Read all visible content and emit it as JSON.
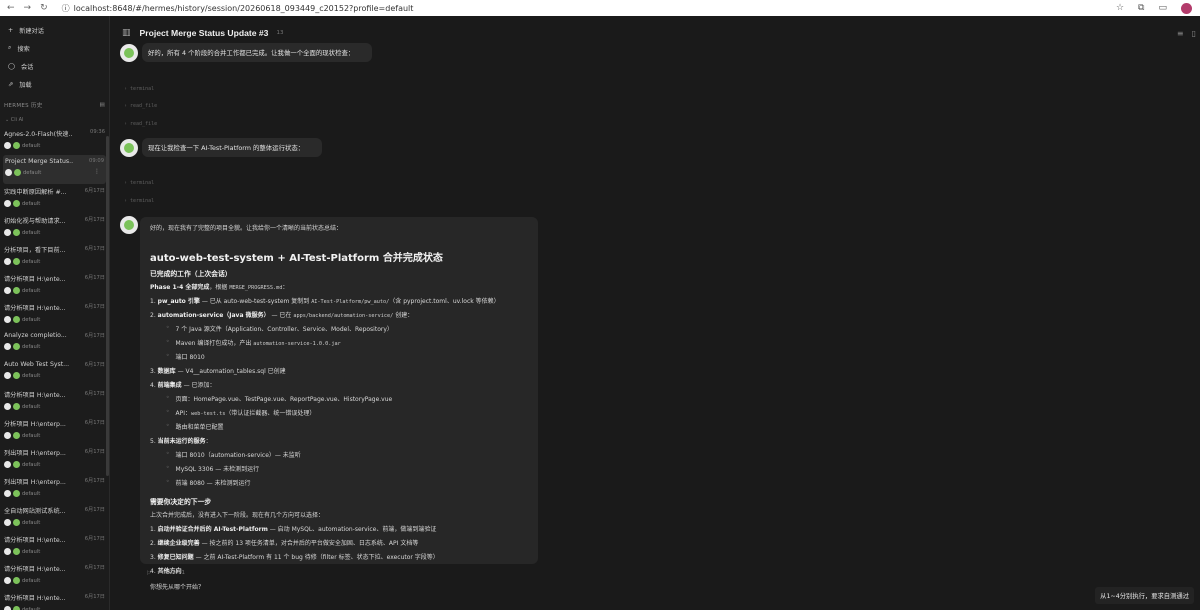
{
  "browser": {
    "url": "localhost:8648/#/hermes/history/session/20260618_093449_c20152?profile=default"
  },
  "sidebar": {
    "top_items": [
      {
        "label": "新建对话",
        "icon": "plus-icon"
      },
      {
        "label": "搜索",
        "icon": "search-icon"
      },
      {
        "label": "会话",
        "icon": "chat-icon"
      },
      {
        "label": "加载",
        "icon": "link-icon"
      }
    ],
    "history_title": "HERMES 历史",
    "group_label": "Cli AI",
    "sessions": [
      {
        "title": "Agnes-2.0-Flash(快速...",
        "date": "09:36",
        "profile": "default",
        "active": false
      },
      {
        "title": "Project Merge Status...",
        "date": "09:09",
        "profile": "default",
        "active": true
      },
      {
        "title": "实践中断原因解析 #...",
        "date": "6月17日",
        "profile": "default",
        "active": false
      },
      {
        "title": "初始化视与帮助请求...",
        "date": "6月17日",
        "profile": "default",
        "active": false
      },
      {
        "title": "分析项目，看下目前...",
        "date": "6月17日",
        "profile": "default",
        "active": false
      },
      {
        "title": "请分析项目 H:\\ente...",
        "date": "6月17日",
        "profile": "default",
        "active": false
      },
      {
        "title": "请分析项目 H:\\ente...",
        "date": "6月17日",
        "profile": "default",
        "active": false
      },
      {
        "title": "Analyze completio...",
        "date": "6月17日",
        "profile": "default",
        "active": false
      },
      {
        "title": "Auto Web Test Syst...",
        "date": "6月17日",
        "profile": "default",
        "active": false
      },
      {
        "title": "请分析项目 H:\\ente...",
        "date": "6月17日",
        "profile": "default",
        "active": false
      },
      {
        "title": "分析项目 H:\\enterp...",
        "date": "6月17日",
        "profile": "default",
        "active": false
      },
      {
        "title": "列出项目 H:\\enterp...",
        "date": "6月17日",
        "profile": "default",
        "active": false
      },
      {
        "title": "列出项目 H:\\enterp...",
        "date": "6月17日",
        "profile": "default",
        "active": false
      },
      {
        "title": "全自动网站测试系统...",
        "date": "6月17日",
        "profile": "default",
        "active": false
      },
      {
        "title": "请分析项目 H:\\ente...",
        "date": "6月17日",
        "profile": "default",
        "active": false
      },
      {
        "title": "请分析项目 H:\\ente...",
        "date": "6月17日",
        "profile": "default",
        "active": false
      },
      {
        "title": "请分析项目 H:\\ente...",
        "date": "6月17日",
        "profile": "default",
        "active": false
      }
    ]
  },
  "header": {
    "title": "Project Merge Status Update #3",
    "count": "13"
  },
  "chat": {
    "msg1": "好的，所有 4 个阶段的合并工作都已完成。让我做一个全面的现状检查：",
    "tools1": [
      "terminal",
      "read_file",
      "read_file"
    ],
    "msg2": "现在让我检查一下 AI-Test-Platform 的整体运行状态：",
    "tools2": [
      "terminal",
      "terminal"
    ],
    "final": {
      "intro": "好的，现在我有了完整的项目全貌。让我给你一个清晰的当前状态总结：",
      "title": "auto-web-test-system + AI-Test-Platform 合并完成状态",
      "section_done": "已完成的工作（上次会话）",
      "phase_line_bold": "Phase 1-4 全部完成",
      "phase_line_rest": "，根据 ",
      "phase_line_code": "MERGE_PROGRESS.md",
      "phase_line_end": "：",
      "items": [
        {
          "num": "1.",
          "bold": "pw_auto 引擎",
          "text": " — 已从 auto-web-test-system 复制到 ",
          "code": "AI-Test-Platform/pw_auto/",
          "tail": "（含 pyproject.toml、uv.lock 等依赖）",
          "subs": []
        },
        {
          "num": "2.",
          "bold": "automation-service（Java 微服务）",
          "text": " — 已在 ",
          "code": "apps/backend/automation-service/",
          "tail": " 创建：",
          "subs": [
            {
              "text": "7 个 Java 源文件（Application、Controller、Service、Model、Repository）",
              "code": ""
            },
            {
              "text": "Maven 编译打包成功，产出 ",
              "code": "automation-service-1.0.0.jar"
            },
            {
              "text": "端口 8010",
              "code": ""
            }
          ]
        },
        {
          "num": "3.",
          "bold": "数据库",
          "text": " — V4__automation_tables.sql 已创建",
          "code": "",
          "tail": "",
          "subs": []
        },
        {
          "num": "4.",
          "bold": "前端集成",
          "text": " — 已添加：",
          "code": "",
          "tail": "",
          "subs": [
            {
              "text": "页面：HomePage.vue、TestPage.vue、ReportPage.vue、HistoryPage.vue",
              "code": ""
            },
            {
              "text": "API：",
              "code": "web-test.ts",
              "tail": "（带认证拦截器、统一错误处理）"
            },
            {
              "text": "路由和菜单已配置",
              "code": ""
            }
          ]
        },
        {
          "num": "5.",
          "bold": "当前未运行的服务",
          "text": "：",
          "code": "",
          "tail": "",
          "subs": [
            {
              "text": "端口 8010（automation-service）— 未监听",
              "code": ""
            },
            {
              "text": "MySQL 3306 — 未检测到运行",
              "code": ""
            },
            {
              "text": "前端 8080 — 未检测到运行",
              "code": ""
            }
          ]
        }
      ],
      "next_title": "需要你决定的下一步",
      "next_intro": "上次合并完成后，没有进入下一阶段。现在有几个方向可以选择：",
      "choices": [
        {
          "num": "1.",
          "bold": "启动并验证合并后的 AI-Test-Platform",
          "text": " — 启动 MySQL、automation-service、前端，做端到端验证"
        },
        {
          "num": "2.",
          "bold": "继续企业级完善",
          "text": " — 按之前的 13 项任务清单，对合并后的平台做安全加固、日志系统、API 文档等"
        },
        {
          "num": "3.",
          "bold": "修复已知问题",
          "text": " — 之前 AI-Test-Platform 有 11 个 bug 待修（filter 标签、状态下拉、executor 字段等）"
        },
        {
          "num": "4.",
          "bold": "其他方向",
          "text": ""
        }
      ],
      "question": "你想先从哪个开始？"
    },
    "actions_time": "09:11"
  },
  "toast": "从1~4分别执行，要求自测通过"
}
